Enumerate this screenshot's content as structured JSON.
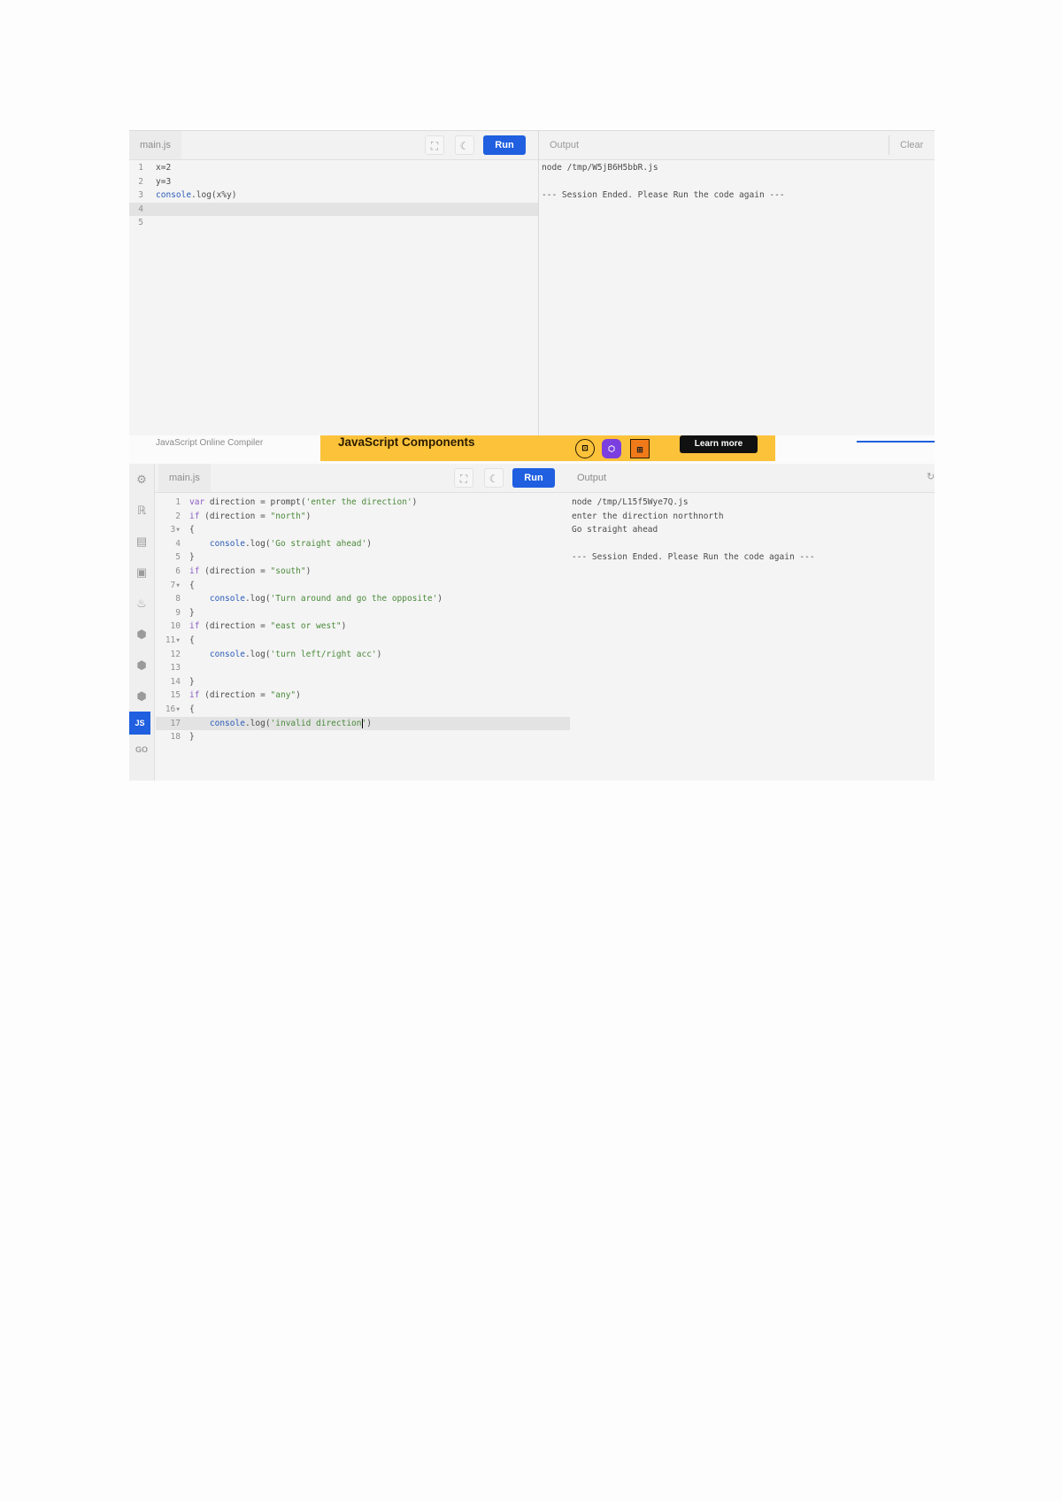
{
  "editor1": {
    "file_tab": "main.js",
    "run_label": "Run",
    "output_label": "Output",
    "clear_label": "Clear",
    "lines": [
      {
        "n": "1",
        "code": "x=2"
      },
      {
        "n": "2",
        "code": "y=3"
      },
      {
        "n": "3",
        "code": "console.log(x%y)"
      },
      {
        "n": "4",
        "code": ""
      },
      {
        "n": "5",
        "code": ""
      }
    ],
    "output_lines": [
      "node /tmp/W5jB6H5bbR.js",
      "",
      "--- Session Ended. Please Run the code again ---"
    ]
  },
  "banner": {
    "compiler_title": "JavaScript Online Compiler",
    "ad_title": "JavaScript Components",
    "learn_more": "Learn more"
  },
  "editor2": {
    "file_tab": "main.js",
    "run_label": "Run",
    "output_label": "Output",
    "active_language": "JS",
    "go_label": "GO",
    "lines": [
      {
        "n": "1",
        "code": "var direction = prompt('enter the direction')"
      },
      {
        "n": "2",
        "code": "if (direction = \"north\")"
      },
      {
        "n": "3",
        "fold": true,
        "code": "{"
      },
      {
        "n": "4",
        "code": "    console.log('Go straight ahead')"
      },
      {
        "n": "5",
        "code": "}"
      },
      {
        "n": "6",
        "code": "if (direction = \"south\")"
      },
      {
        "n": "7",
        "fold": true,
        "code": "{"
      },
      {
        "n": "8",
        "code": "    console.log('Turn around and go the opposite')"
      },
      {
        "n": "9",
        "code": "}"
      },
      {
        "n": "10",
        "code": "if (direction = \"east or west\")"
      },
      {
        "n": "11",
        "fold": true,
        "code": "{"
      },
      {
        "n": "12",
        "code": "    console.log('turn left/right acc')"
      },
      {
        "n": "13",
        "code": ""
      },
      {
        "n": "14",
        "code": "}"
      },
      {
        "n": "15",
        "code": "if (direction = \"any\")"
      },
      {
        "n": "16",
        "fold": true,
        "code": "{"
      },
      {
        "n": "17",
        "code": "    console.log('invalid direction')"
      },
      {
        "n": "18",
        "code": "}"
      }
    ],
    "output_lines": [
      "node /tmp/L15f5Wye7Q.js",
      "enter the direction northnorth",
      "Go straight ahead",
      "",
      "--- Session Ended. Please Run the code again ---"
    ]
  }
}
